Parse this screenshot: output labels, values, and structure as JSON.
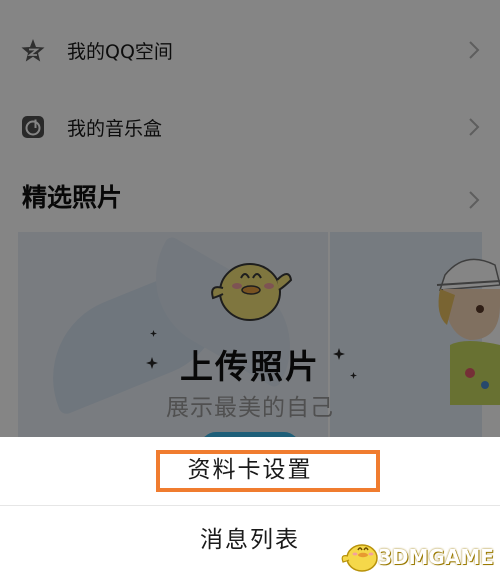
{
  "menu": {
    "items": [
      {
        "label": "我的QQ空间",
        "icon": "star-icon"
      },
      {
        "label": "我的音乐盒",
        "icon": "music-box-icon"
      }
    ]
  },
  "photos": {
    "section_title": "精选照片",
    "upload_title": "上传照片",
    "upload_subtitle": "展示最美的自己"
  },
  "action_sheet": {
    "items": [
      {
        "label": "资料卡设置",
        "highlighted": true
      },
      {
        "label": "消息列表",
        "highlighted": false
      }
    ]
  },
  "watermark": {
    "text": "3DMGAME"
  },
  "colors": {
    "overlay": "rgba(0,0,0,0.48)",
    "highlight_border": "#f07c2f",
    "upload_button": "#3ab7e8"
  }
}
